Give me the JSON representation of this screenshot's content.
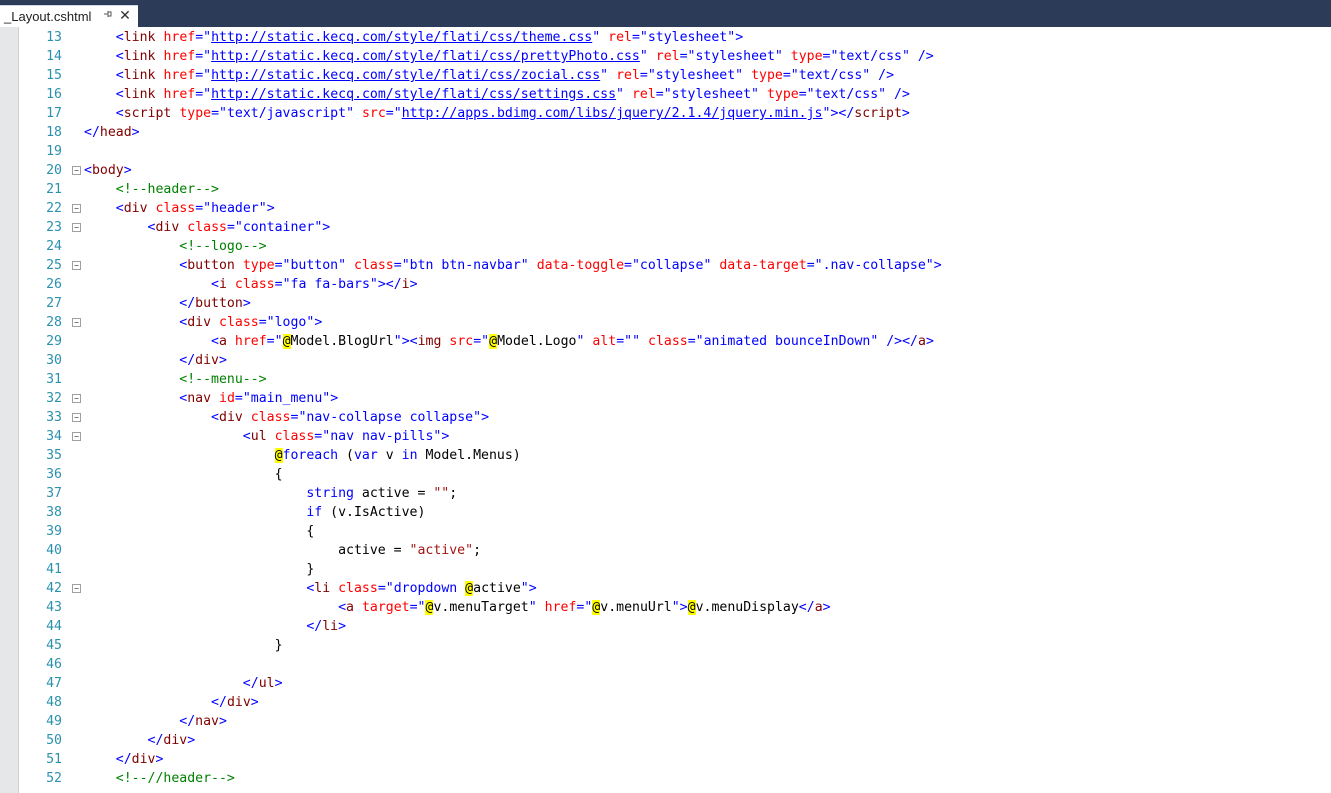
{
  "tab": {
    "label": "_Layout.cshtml",
    "pin_icon": "pin-icon",
    "close_icon": "close-icon"
  },
  "colors": {
    "chrome_bg": "#2b3b58",
    "line_number": "#2b91af",
    "tag": "#800000",
    "attribute": "#ff0000",
    "value": "#0000ff",
    "comment": "#008000",
    "string": "#a31515",
    "razor_highlight": "#ffff00"
  },
  "lines": [
    {
      "n": "13",
      "fold": "",
      "indent": "    ",
      "segs": [
        [
          "p",
          "<"
        ],
        [
          "t",
          "link"
        ],
        [
          "x",
          " "
        ],
        [
          "a",
          "href"
        ],
        [
          "p",
          "="
        ],
        [
          "v",
          "\""
        ],
        [
          "l",
          "http://static.kecq.com/style/flati/css/theme.css"
        ],
        [
          "v",
          "\""
        ],
        [
          "x",
          " "
        ],
        [
          "a",
          "rel"
        ],
        [
          "p",
          "="
        ],
        [
          "v",
          "\"stylesheet\""
        ],
        [
          "p",
          ">"
        ]
      ]
    },
    {
      "n": "14",
      "fold": "",
      "indent": "    ",
      "segs": [
        [
          "p",
          "<"
        ],
        [
          "t",
          "link"
        ],
        [
          "x",
          " "
        ],
        [
          "a",
          "href"
        ],
        [
          "p",
          "="
        ],
        [
          "v",
          "\""
        ],
        [
          "l",
          "http://static.kecq.com/style/flati/css/prettyPhoto.css"
        ],
        [
          "v",
          "\""
        ],
        [
          "x",
          " "
        ],
        [
          "a",
          "rel"
        ],
        [
          "p",
          "="
        ],
        [
          "v",
          "\"stylesheet\""
        ],
        [
          "x",
          " "
        ],
        [
          "a",
          "type"
        ],
        [
          "p",
          "="
        ],
        [
          "v",
          "\"text/css\""
        ],
        [
          "x",
          " "
        ],
        [
          "p",
          "/>"
        ]
      ]
    },
    {
      "n": "15",
      "fold": "",
      "indent": "    ",
      "segs": [
        [
          "p",
          "<"
        ],
        [
          "t",
          "link"
        ],
        [
          "x",
          " "
        ],
        [
          "a",
          "href"
        ],
        [
          "p",
          "="
        ],
        [
          "v",
          "\""
        ],
        [
          "l",
          "http://static.kecq.com/style/flati/css/zocial.css"
        ],
        [
          "v",
          "\""
        ],
        [
          "x",
          " "
        ],
        [
          "a",
          "rel"
        ],
        [
          "p",
          "="
        ],
        [
          "v",
          "\"stylesheet\""
        ],
        [
          "x",
          " "
        ],
        [
          "a",
          "type"
        ],
        [
          "p",
          "="
        ],
        [
          "v",
          "\"text/css\""
        ],
        [
          "x",
          " "
        ],
        [
          "p",
          "/>"
        ]
      ]
    },
    {
      "n": "16",
      "fold": "",
      "indent": "    ",
      "segs": [
        [
          "p",
          "<"
        ],
        [
          "t",
          "link"
        ],
        [
          "x",
          " "
        ],
        [
          "a",
          "href"
        ],
        [
          "p",
          "="
        ],
        [
          "v",
          "\""
        ],
        [
          "l",
          "http://static.kecq.com/style/flati/css/settings.css"
        ],
        [
          "v",
          "\""
        ],
        [
          "x",
          " "
        ],
        [
          "a",
          "rel"
        ],
        [
          "p",
          "="
        ],
        [
          "v",
          "\"stylesheet\""
        ],
        [
          "x",
          " "
        ],
        [
          "a",
          "type"
        ],
        [
          "p",
          "="
        ],
        [
          "v",
          "\"text/css\""
        ],
        [
          "x",
          " "
        ],
        [
          "p",
          "/>"
        ]
      ]
    },
    {
      "n": "17",
      "fold": "",
      "indent": "    ",
      "segs": [
        [
          "p",
          "<"
        ],
        [
          "t",
          "script"
        ],
        [
          "x",
          " "
        ],
        [
          "a",
          "type"
        ],
        [
          "p",
          "="
        ],
        [
          "v",
          "\"text/javascript\""
        ],
        [
          "x",
          " "
        ],
        [
          "a",
          "src"
        ],
        [
          "p",
          "="
        ],
        [
          "v",
          "\""
        ],
        [
          "l",
          "http://apps.bdimg.com/libs/jquery/2.1.4/jquery.min.js"
        ],
        [
          "v",
          "\""
        ],
        [
          "p",
          "></"
        ],
        [
          "t",
          "script"
        ],
        [
          "p",
          ">"
        ]
      ]
    },
    {
      "n": "18",
      "fold": "",
      "indent": "",
      "segs": [
        [
          "p",
          "</"
        ],
        [
          "t",
          "head"
        ],
        [
          "p",
          ">"
        ]
      ]
    },
    {
      "n": "19",
      "fold": "",
      "indent": "",
      "segs": []
    },
    {
      "n": "20",
      "fold": "−",
      "indent": "",
      "segs": [
        [
          "p",
          "<"
        ],
        [
          "t",
          "body"
        ],
        [
          "p",
          ">"
        ]
      ]
    },
    {
      "n": "21",
      "fold": "",
      "indent": "    ",
      "segs": [
        [
          "c",
          "<!--header-->"
        ]
      ]
    },
    {
      "n": "22",
      "fold": "−",
      "indent": "    ",
      "segs": [
        [
          "p",
          "<"
        ],
        [
          "t",
          "div"
        ],
        [
          "x",
          " "
        ],
        [
          "a",
          "class"
        ],
        [
          "p",
          "="
        ],
        [
          "v",
          "\"header\""
        ],
        [
          "p",
          ">"
        ]
      ]
    },
    {
      "n": "23",
      "fold": "−",
      "indent": "        ",
      "segs": [
        [
          "p",
          "<"
        ],
        [
          "t",
          "div"
        ],
        [
          "x",
          " "
        ],
        [
          "a",
          "class"
        ],
        [
          "p",
          "="
        ],
        [
          "v",
          "\"container\""
        ],
        [
          "p",
          ">"
        ]
      ]
    },
    {
      "n": "24",
      "fold": "",
      "indent": "            ",
      "segs": [
        [
          "c",
          "<!--logo-->"
        ]
      ]
    },
    {
      "n": "25",
      "fold": "−",
      "indent": "            ",
      "segs": [
        [
          "p",
          "<"
        ],
        [
          "t",
          "button"
        ],
        [
          "x",
          " "
        ],
        [
          "a",
          "type"
        ],
        [
          "p",
          "="
        ],
        [
          "v",
          "\"button\""
        ],
        [
          "x",
          " "
        ],
        [
          "a",
          "class"
        ],
        [
          "p",
          "="
        ],
        [
          "v",
          "\"btn btn-navbar\""
        ],
        [
          "x",
          " "
        ],
        [
          "a",
          "data-toggle"
        ],
        [
          "p",
          "="
        ],
        [
          "v",
          "\"collapse\""
        ],
        [
          "x",
          " "
        ],
        [
          "a",
          "data-target"
        ],
        [
          "p",
          "="
        ],
        [
          "v",
          "\".nav-collapse\""
        ],
        [
          "p",
          ">"
        ]
      ]
    },
    {
      "n": "26",
      "fold": "",
      "indent": "                ",
      "segs": [
        [
          "p",
          "<"
        ],
        [
          "t",
          "i"
        ],
        [
          "x",
          " "
        ],
        [
          "a",
          "class"
        ],
        [
          "p",
          "="
        ],
        [
          "v",
          "\"fa fa-bars\""
        ],
        [
          "p",
          "></"
        ],
        [
          "t",
          "i"
        ],
        [
          "p",
          ">"
        ]
      ]
    },
    {
      "n": "27",
      "fold": "",
      "indent": "            ",
      "segs": [
        [
          "p",
          "</"
        ],
        [
          "t",
          "button"
        ],
        [
          "p",
          ">"
        ]
      ]
    },
    {
      "n": "28",
      "fold": "−",
      "indent": "            ",
      "segs": [
        [
          "p",
          "<"
        ],
        [
          "t",
          "div"
        ],
        [
          "x",
          " "
        ],
        [
          "a",
          "class"
        ],
        [
          "p",
          "="
        ],
        [
          "v",
          "\"logo\""
        ],
        [
          "p",
          ">"
        ]
      ]
    },
    {
      "n": "29",
      "fold": "",
      "indent": "                ",
      "segs": [
        [
          "p",
          "<"
        ],
        [
          "t",
          "a"
        ],
        [
          "x",
          " "
        ],
        [
          "a",
          "href"
        ],
        [
          "p",
          "="
        ],
        [
          "v",
          "\""
        ],
        [
          "@",
          "@"
        ],
        [
          "x",
          "Model.BlogUrl"
        ],
        [
          "v",
          "\""
        ],
        [
          "p",
          "><"
        ],
        [
          "t",
          "img"
        ],
        [
          "x",
          " "
        ],
        [
          "a",
          "src"
        ],
        [
          "p",
          "="
        ],
        [
          "v",
          "\""
        ],
        [
          "@",
          "@"
        ],
        [
          "x",
          "Model.Logo"
        ],
        [
          "v",
          "\""
        ],
        [
          "x",
          " "
        ],
        [
          "a",
          "alt"
        ],
        [
          "p",
          "="
        ],
        [
          "v",
          "\"\""
        ],
        [
          "x",
          " "
        ],
        [
          "a",
          "class"
        ],
        [
          "p",
          "="
        ],
        [
          "v",
          "\"animated bounceInDown\""
        ],
        [
          "x",
          " "
        ],
        [
          "p",
          "/></"
        ],
        [
          "t",
          "a"
        ],
        [
          "p",
          ">"
        ]
      ]
    },
    {
      "n": "30",
      "fold": "",
      "indent": "            ",
      "segs": [
        [
          "p",
          "</"
        ],
        [
          "t",
          "div"
        ],
        [
          "p",
          ">"
        ]
      ]
    },
    {
      "n": "31",
      "fold": "",
      "indent": "            ",
      "segs": [
        [
          "c",
          "<!--menu-->"
        ]
      ]
    },
    {
      "n": "32",
      "fold": "−",
      "indent": "            ",
      "segs": [
        [
          "p",
          "<"
        ],
        [
          "t",
          "nav"
        ],
        [
          "x",
          " "
        ],
        [
          "a",
          "id"
        ],
        [
          "p",
          "="
        ],
        [
          "v",
          "\"main_menu\""
        ],
        [
          "p",
          ">"
        ]
      ]
    },
    {
      "n": "33",
      "fold": "−",
      "indent": "                ",
      "segs": [
        [
          "p",
          "<"
        ],
        [
          "t",
          "div"
        ],
        [
          "x",
          " "
        ],
        [
          "a",
          "class"
        ],
        [
          "p",
          "="
        ],
        [
          "v",
          "\"nav-collapse collapse\""
        ],
        [
          "p",
          ">"
        ]
      ]
    },
    {
      "n": "34",
      "fold": "−",
      "indent": "                    ",
      "segs": [
        [
          "p",
          "<"
        ],
        [
          "t",
          "ul"
        ],
        [
          "x",
          " "
        ],
        [
          "a",
          "class"
        ],
        [
          "p",
          "="
        ],
        [
          "v",
          "\"nav nav-pills\""
        ],
        [
          "p",
          ">"
        ]
      ]
    },
    {
      "n": "35",
      "fold": "",
      "indent": "                        ",
      "segs": [
        [
          "@",
          "@"
        ],
        [
          "k",
          "foreach"
        ],
        [
          "x",
          " ("
        ],
        [
          "k",
          "var"
        ],
        [
          "x",
          " v "
        ],
        [
          "k",
          "in"
        ],
        [
          "x",
          " Model.Menus)"
        ]
      ]
    },
    {
      "n": "36",
      "fold": "",
      "indent": "                        ",
      "segs": [
        [
          "x",
          "{"
        ]
      ]
    },
    {
      "n": "37",
      "fold": "",
      "indent": "                            ",
      "segs": [
        [
          "k",
          "string"
        ],
        [
          "x",
          " active = "
        ],
        [
          "s",
          "\"\""
        ],
        [
          "x",
          ";"
        ]
      ]
    },
    {
      "n": "38",
      "fold": "",
      "indent": "                            ",
      "segs": [
        [
          "k",
          "if"
        ],
        [
          "x",
          " (v.IsActive)"
        ]
      ]
    },
    {
      "n": "39",
      "fold": "",
      "indent": "                            ",
      "segs": [
        [
          "x",
          "{"
        ]
      ]
    },
    {
      "n": "40",
      "fold": "",
      "indent": "                                ",
      "segs": [
        [
          "x",
          "active = "
        ],
        [
          "s",
          "\"active\""
        ],
        [
          "x",
          ";"
        ]
      ]
    },
    {
      "n": "41",
      "fold": "",
      "indent": "                            ",
      "segs": [
        [
          "x",
          "}"
        ]
      ]
    },
    {
      "n": "42",
      "fold": "−",
      "indent": "                            ",
      "segs": [
        [
          "p",
          "<"
        ],
        [
          "t",
          "li"
        ],
        [
          "x",
          " "
        ],
        [
          "a",
          "class"
        ],
        [
          "p",
          "="
        ],
        [
          "v",
          "\"dropdown "
        ],
        [
          "@",
          "@"
        ],
        [
          "x",
          "active"
        ],
        [
          "v",
          "\""
        ],
        [
          "p",
          ">"
        ]
      ]
    },
    {
      "n": "43",
      "fold": "",
      "indent": "                                ",
      "segs": [
        [
          "p",
          "<"
        ],
        [
          "t",
          "a"
        ],
        [
          "x",
          " "
        ],
        [
          "a",
          "target"
        ],
        [
          "p",
          "="
        ],
        [
          "v",
          "\""
        ],
        [
          "@",
          "@"
        ],
        [
          "x",
          "v.menuTarget"
        ],
        [
          "v",
          "\""
        ],
        [
          "x",
          " "
        ],
        [
          "a",
          "href"
        ],
        [
          "p",
          "="
        ],
        [
          "v",
          "\""
        ],
        [
          "@",
          "@"
        ],
        [
          "x",
          "v.menuUrl"
        ],
        [
          "v",
          "\""
        ],
        [
          "p",
          ">"
        ],
        [
          "@",
          "@"
        ],
        [
          "x",
          "v.menuDisplay"
        ],
        [
          "p",
          "</"
        ],
        [
          "t",
          "a"
        ],
        [
          "p",
          ">"
        ]
      ]
    },
    {
      "n": "44",
      "fold": "",
      "indent": "                            ",
      "segs": [
        [
          "p",
          "</"
        ],
        [
          "t",
          "li"
        ],
        [
          "p",
          ">"
        ]
      ]
    },
    {
      "n": "45",
      "fold": "",
      "indent": "                        ",
      "segs": [
        [
          "x",
          "}"
        ]
      ]
    },
    {
      "n": "46",
      "fold": "",
      "indent": "",
      "segs": []
    },
    {
      "n": "47",
      "fold": "",
      "indent": "                    ",
      "segs": [
        [
          "p",
          "</"
        ],
        [
          "t",
          "ul"
        ],
        [
          "p",
          ">"
        ]
      ]
    },
    {
      "n": "48",
      "fold": "",
      "indent": "                ",
      "segs": [
        [
          "p",
          "</"
        ],
        [
          "t",
          "div"
        ],
        [
          "p",
          ">"
        ]
      ]
    },
    {
      "n": "49",
      "fold": "",
      "indent": "            ",
      "segs": [
        [
          "p",
          "</"
        ],
        [
          "t",
          "nav"
        ],
        [
          "p",
          ">"
        ]
      ]
    },
    {
      "n": "50",
      "fold": "",
      "indent": "        ",
      "segs": [
        [
          "p",
          "</"
        ],
        [
          "t",
          "div"
        ],
        [
          "p",
          ">"
        ]
      ]
    },
    {
      "n": "51",
      "fold": "",
      "indent": "    ",
      "segs": [
        [
          "p",
          "</"
        ],
        [
          "t",
          "div"
        ],
        [
          "p",
          ">"
        ]
      ]
    },
    {
      "n": "52",
      "fold": "",
      "indent": "    ",
      "segs": [
        [
          "c",
          "<!--//header-->"
        ]
      ]
    }
  ]
}
